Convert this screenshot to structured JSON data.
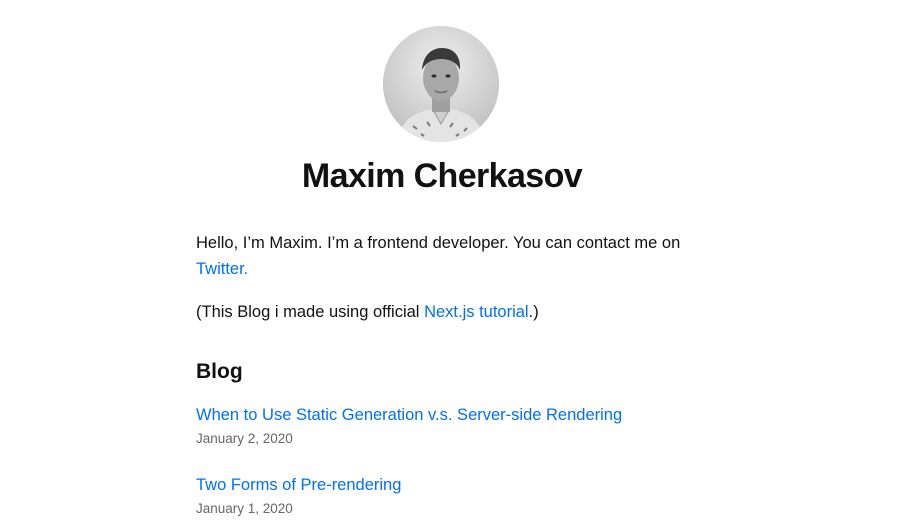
{
  "profile": {
    "name": "Maxim Cherkasov",
    "avatar_alt": "Maxim Cherkasov"
  },
  "intro": {
    "text_before": "Hello, I’m Maxim. I’m a frontend developer. You can contact me on ",
    "twitter_label": "Twitter."
  },
  "note": {
    "text_before": "(This Blog i made using official ",
    "link_label": "Next.js tutorial",
    "text_after": ".)"
  },
  "blog": {
    "heading": "Blog",
    "posts": [
      {
        "title": "When to Use Static Generation v.s. Server-side Rendering",
        "date": "January 2, 2020"
      },
      {
        "title": "Two Forms of Pre-rendering",
        "date": "January 1, 2020"
      }
    ]
  },
  "colors": {
    "link": "#0070f3",
    "text": "#111111",
    "date": "#666666"
  }
}
